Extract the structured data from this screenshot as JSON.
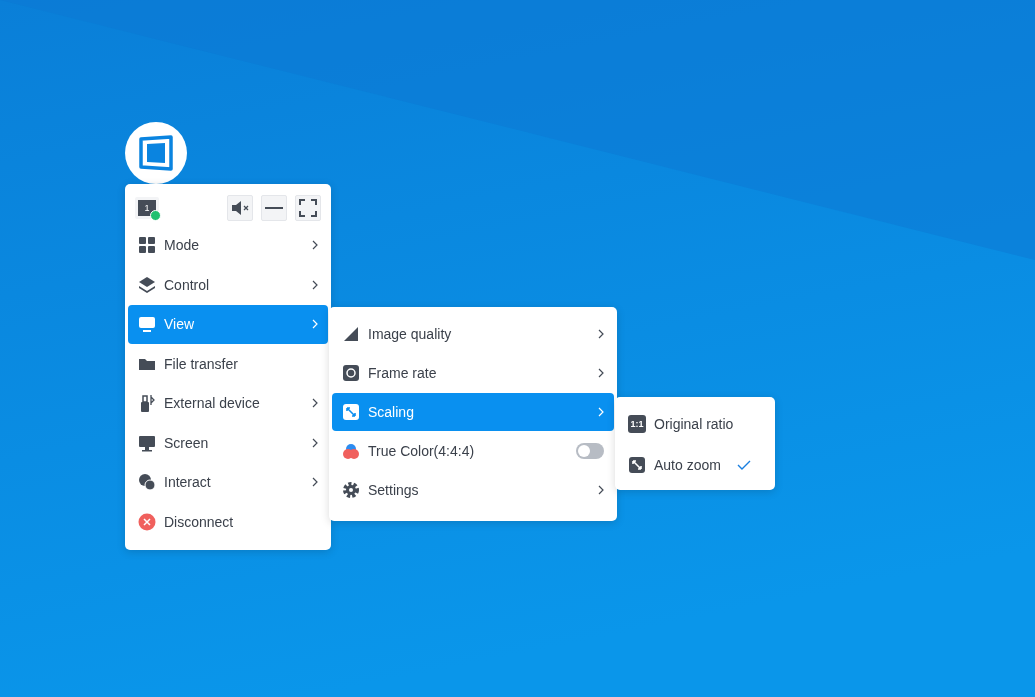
{
  "toolbar": {
    "monitor_number": "1"
  },
  "main_menu": [
    {
      "label": "Mode",
      "submenu": true,
      "selected": false
    },
    {
      "label": "Control",
      "submenu": true,
      "selected": false
    },
    {
      "label": "View",
      "submenu": true,
      "selected": true
    },
    {
      "label": "File transfer",
      "submenu": false,
      "selected": false
    },
    {
      "label": "External device",
      "submenu": true,
      "selected": false
    },
    {
      "label": "Screen",
      "submenu": true,
      "selected": false
    },
    {
      "label": "Interact",
      "submenu": true,
      "selected": false
    },
    {
      "label": "Disconnect",
      "submenu": false,
      "selected": false
    }
  ],
  "view_menu": [
    {
      "label": "Image quality",
      "kind": "submenu",
      "selected": false
    },
    {
      "label": "Frame rate",
      "kind": "submenu",
      "selected": false
    },
    {
      "label": "Scaling",
      "kind": "submenu",
      "selected": true
    },
    {
      "label": "True Color(4:4:4)",
      "kind": "toggle",
      "on": false,
      "selected": false
    },
    {
      "label": "Settings",
      "kind": "submenu",
      "selected": false
    }
  ],
  "scaling_menu": [
    {
      "label": "Original ratio",
      "icon_text": "1:1",
      "checked": false
    },
    {
      "label": "Auto zoom",
      "checked": true
    }
  ]
}
